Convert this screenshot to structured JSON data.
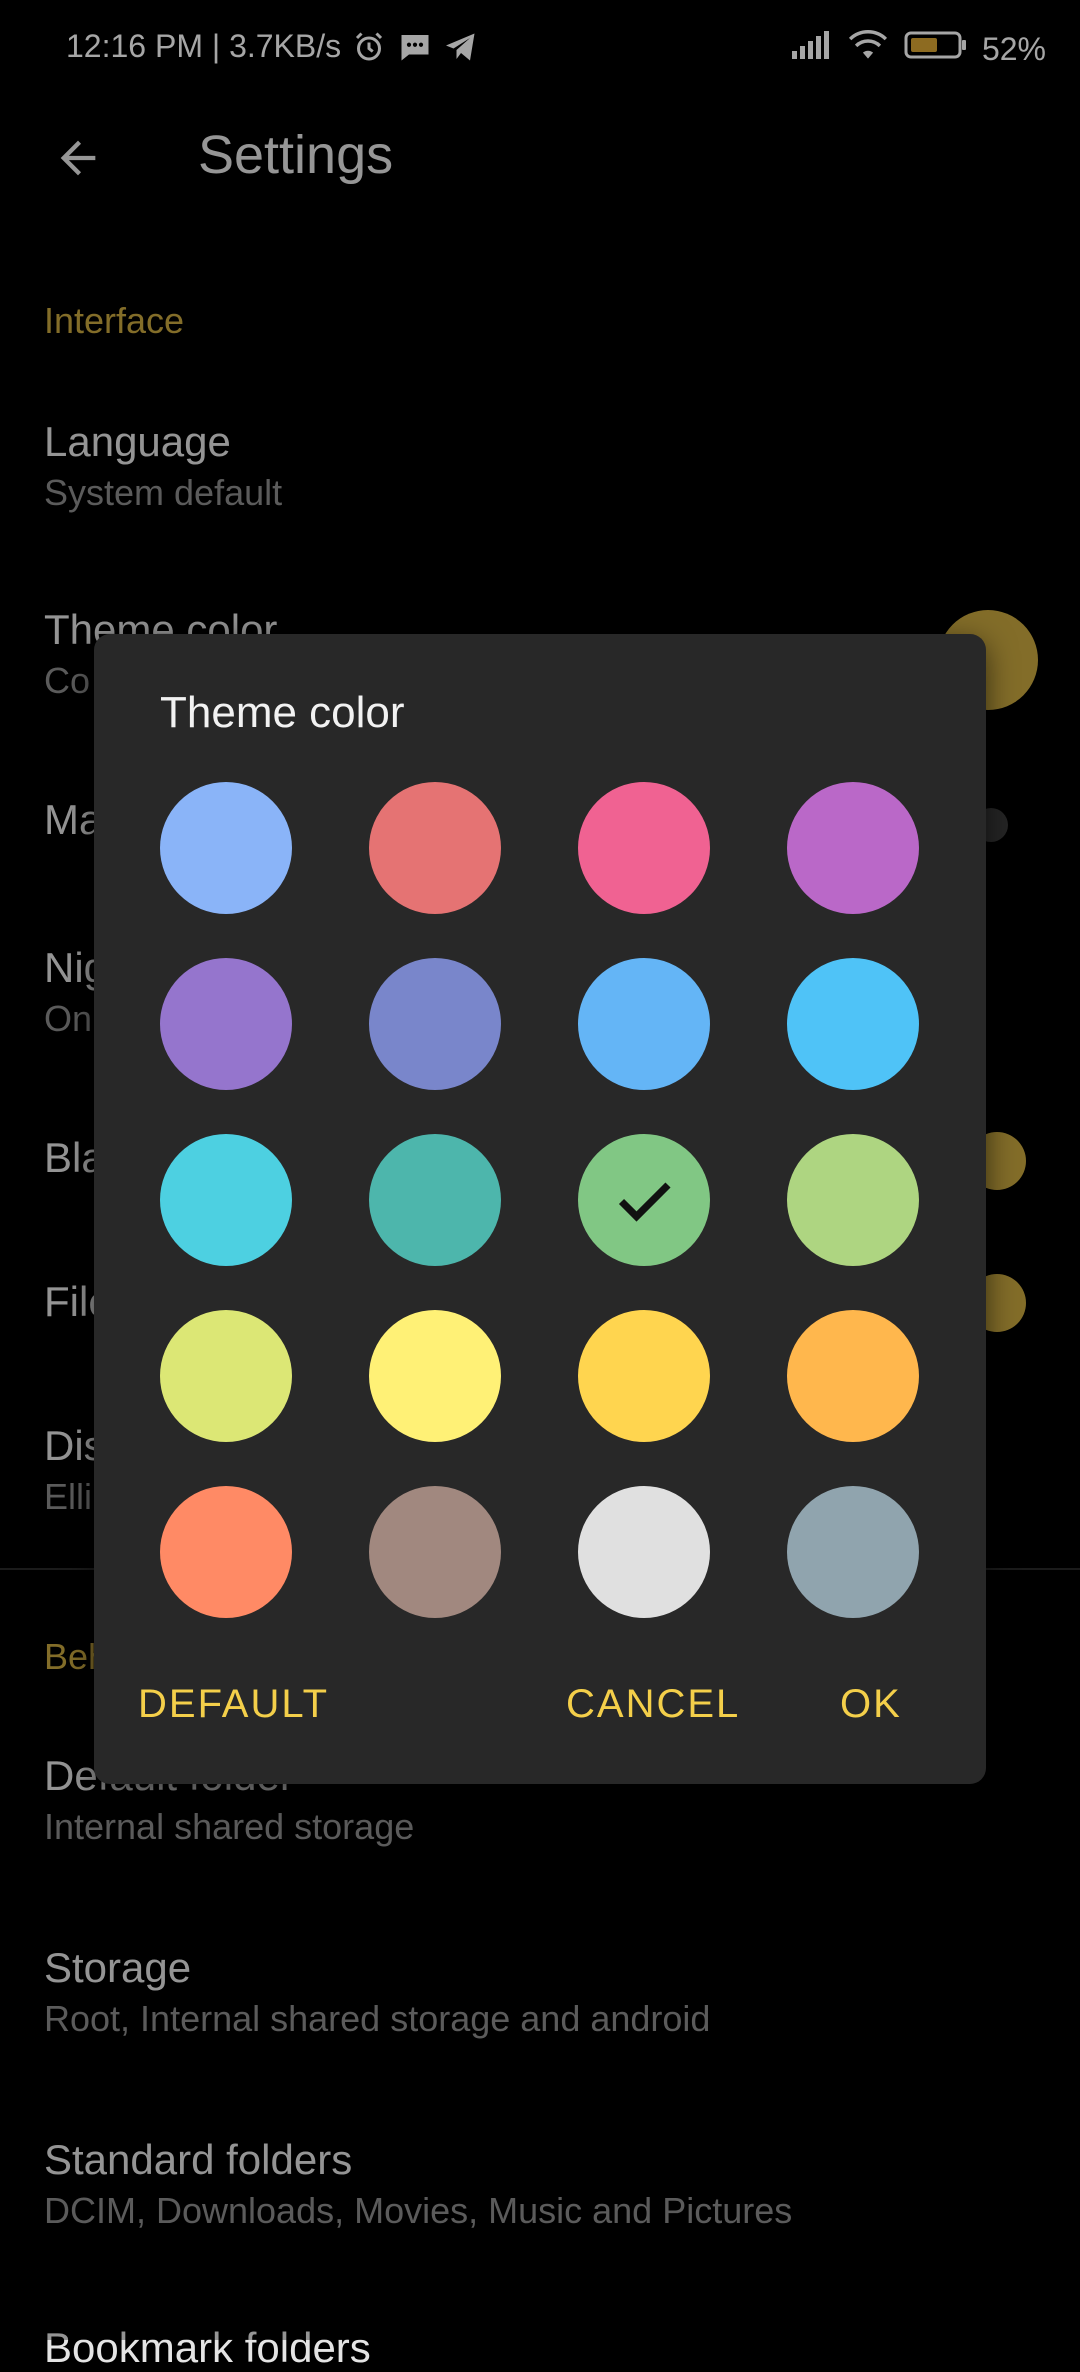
{
  "status_bar": {
    "time_speed": "12:16 PM | 3.7KB/s",
    "battery_percent": "52%"
  },
  "app_bar": {
    "title": "Settings",
    "back_icon": "arrow-back-icon"
  },
  "settings": {
    "interface_header": "Interface",
    "language_title": "Language",
    "language_sub": "System default",
    "theme_title": "Theme color",
    "theme_sub": "Co",
    "ma_title": "Ma",
    "night_title": "Nig",
    "night_sub": "On",
    "black_title": "Bla",
    "file_title": "File",
    "display_title": "Dis",
    "display_sub": "Elli",
    "behavior_header": "Beh",
    "default_folder_title": "Default folder",
    "default_folder_sub": "Internal shared storage",
    "storage_title": "Storage",
    "storage_sub": "Root, Internal shared storage and android",
    "standard_title": "Standard folders",
    "standard_sub": "DCIM, Downloads, Movies, Music and Pictures",
    "bookmark_title": "Bookmark folders",
    "accent_color": "#c9a83f"
  },
  "dialog": {
    "title": "Theme color",
    "selected_index": 10,
    "colors": [
      "#8AB4F8",
      "#E57373",
      "#F06292",
      "#BA68C8",
      "#9575CD",
      "#7986CB",
      "#64B5F6",
      "#4FC3F7",
      "#4DD0E1",
      "#4DB6AC",
      "#81C784",
      "#AED581",
      "#DCE775",
      "#FFF176",
      "#FFD54F",
      "#FFB74D",
      "#FF8A65",
      "#A1887F",
      "#E0E0E0",
      "#90A4AE"
    ],
    "default_label": "DEFAULT",
    "cancel_label": "CANCEL",
    "ok_label": "OK",
    "action_color": "#f4cf4a"
  }
}
